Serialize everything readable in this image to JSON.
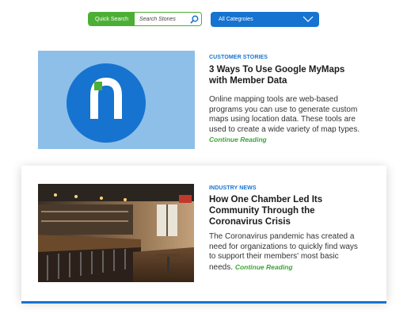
{
  "search": {
    "label": "Quick Search",
    "placeholder": "Search Stories"
  },
  "category_filter": {
    "selected": "All Categroies"
  },
  "stories": [
    {
      "category": "CUSTOMER STORIES",
      "title": "3 Ways To Use Google MyMaps with Member Data",
      "excerpt": "Online mapping tools are web-based programs you can use to generate custom maps using location data. These tools are used to create a wide variety of map types.",
      "link_label": "Continue Reading",
      "image": "logo-n-icon"
    },
    {
      "category": "INDUSTRY NEWS",
      "title": "How One Chamber Led Its Community Through the Coronavirus Crisis",
      "excerpt": "The Coronavirus pandemic has created a need for organizations to quickly find ways to support their members' most basic needs.",
      "link_label": "Continue Reading",
      "image": "restaurant-bar-photo"
    }
  ],
  "colors": {
    "accent_blue": "#1673d0",
    "accent_green": "#4caf35",
    "link_green": "#3aa635",
    "thumb_light_blue": "#8dbfe8"
  }
}
